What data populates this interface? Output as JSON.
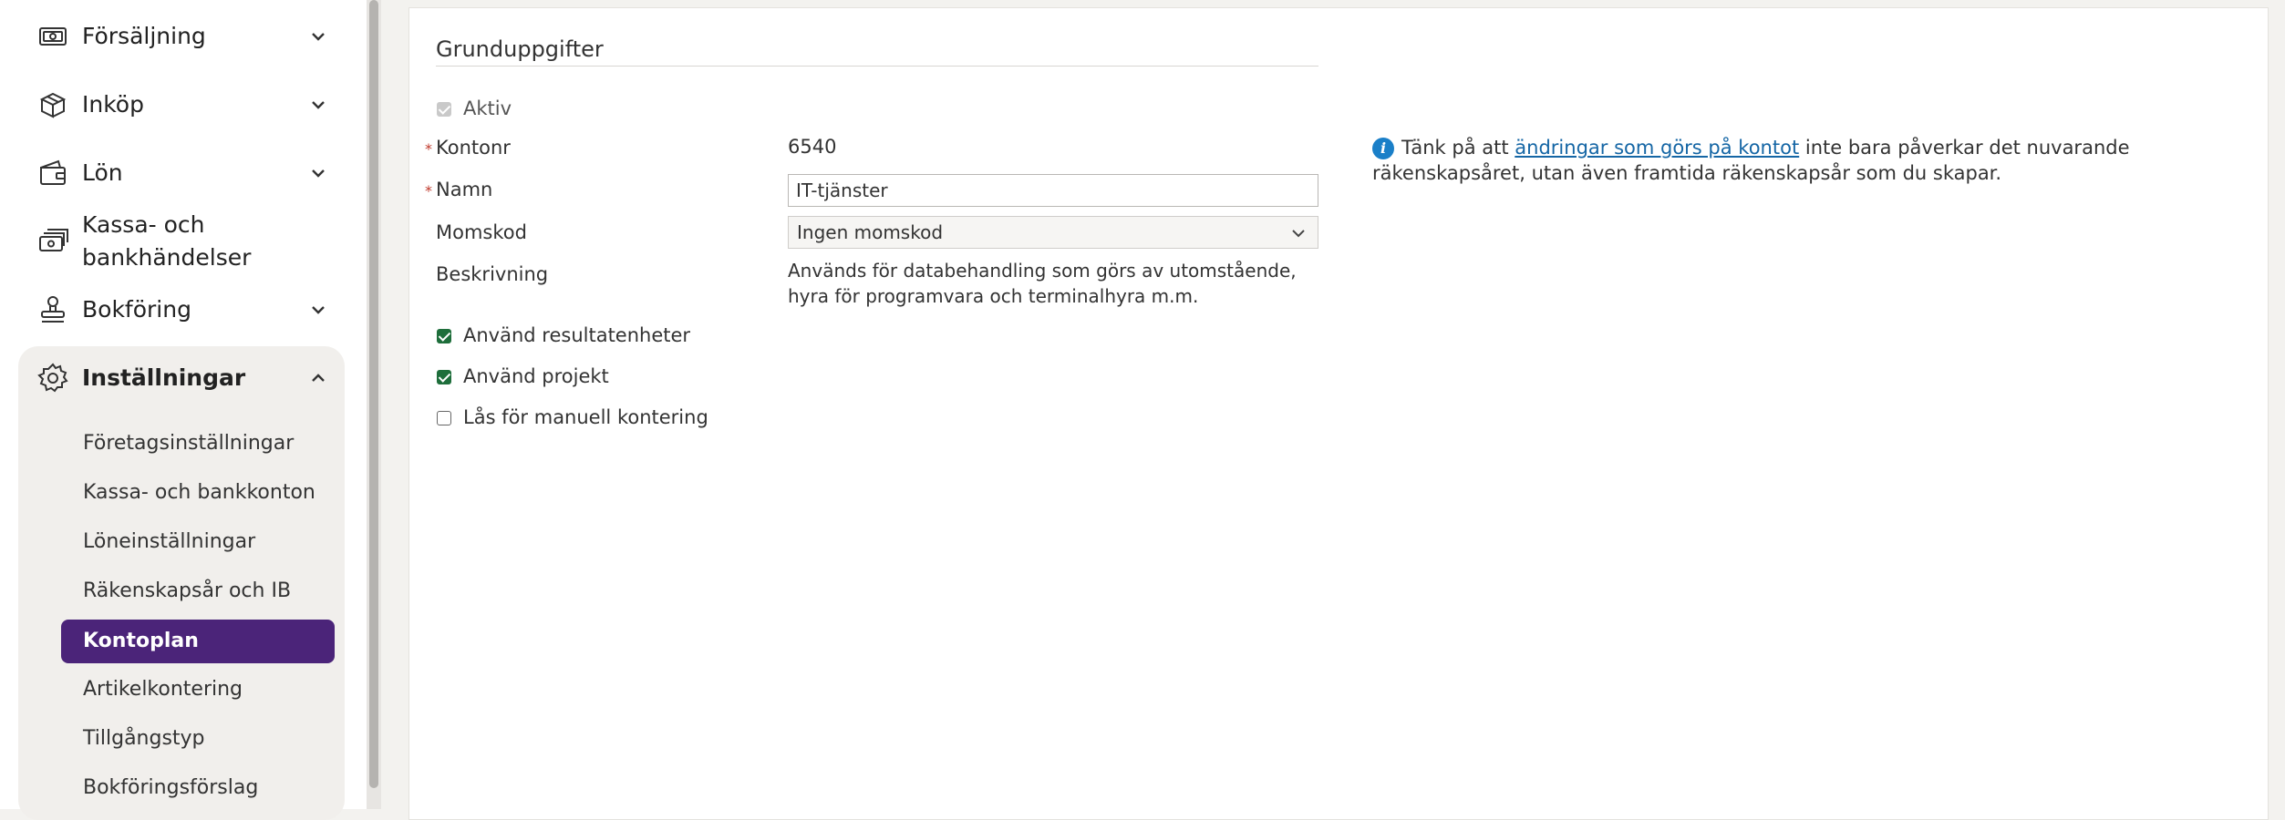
{
  "sidebar": {
    "items": [
      {
        "label": "Försäljning",
        "icon": "cash-icon"
      },
      {
        "label": "Inköp",
        "icon": "boxes-icon"
      },
      {
        "label": "Lön",
        "icon": "wallet-icon"
      },
      {
        "label_line1": "Kassa- och",
        "label_line2": "bankhändelser",
        "icon": "cash-register-icon"
      },
      {
        "label": "Bokföring",
        "icon": "stamp-icon"
      },
      {
        "label": "Inställningar",
        "icon": "gear-icon"
      }
    ],
    "settings_sub": [
      "Företagsinställningar",
      "Kassa- och bankkonton",
      "Löneinställningar",
      "Räkenskapsår och IB",
      "Kontoplan",
      "Artikelkontering",
      "Tillgångstyp",
      "Bokföringsförslag"
    ]
  },
  "form": {
    "section_title": "Grunduppgifter",
    "aktiv_label": "Aktiv",
    "required_mark": "*",
    "kontonr_label": "Kontonr",
    "kontonr_value": "6540",
    "namn_label": "Namn",
    "namn_value": "IT-tjänster",
    "momskod_label": "Momskod",
    "momskod_value": "Ingen momskod",
    "beskrivning_label": "Beskrivning",
    "beskrivning_value": "Används för databehandling som görs av utomstående, hyra för programvara och terminalhyra m.m.",
    "checkbox_resultat": "Använd resultatenheter",
    "checkbox_projekt": "Använd projekt",
    "checkbox_las": "Lås för manuell kontering"
  },
  "info": {
    "icon": "info-icon",
    "prefix": "Tänk på att ",
    "link": "ändringar som görs på kontot",
    "suffix": " inte bara påverkar det nuvarande räkenskapsåret, utan även framtida räkenskapsår som du skapar.",
    "color": "#1a7fc8"
  },
  "colors": {
    "active_item": "#4b2479",
    "checkbox_checked": "#1e6e3b",
    "required": "#c0392b",
    "link": "#1566a5"
  }
}
